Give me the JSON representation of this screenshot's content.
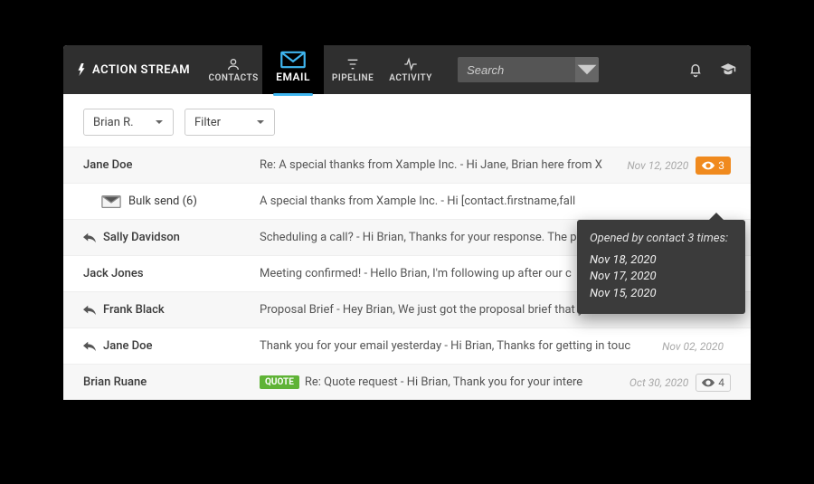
{
  "header": {
    "brand": "ACTION STREAM",
    "nav": [
      {
        "key": "contacts",
        "label": "CONTACTS"
      },
      {
        "key": "email",
        "label": "EMAIL",
        "active": true
      },
      {
        "key": "pipeline",
        "label": "PIPELINE"
      },
      {
        "key": "activity",
        "label": "ACTIVITY"
      }
    ],
    "search_placeholder": "Search"
  },
  "filters": {
    "person": "Brian R.",
    "label": "Filter"
  },
  "tooltip": {
    "head": "Opened by contact 3 times:",
    "dates": [
      "Nov 18, 2020",
      "Nov 17, 2020",
      "Nov 15, 2020"
    ]
  },
  "rows": [
    {
      "kind": "normal",
      "sender": "Jane Doe",
      "body": "Re: A special thanks from Xample Inc. - Hi Jane, Brian here from X",
      "date": "Nov 12, 2020",
      "opens": "3",
      "opens_hot": true
    },
    {
      "kind": "bulk",
      "sender": "Bulk send (6)",
      "body": "A special thanks from Xample Inc. - Hi [contact.firstname,fall",
      "date": "",
      "opens": ""
    },
    {
      "kind": "reply",
      "sender": "Sally Davidson",
      "body": "Scheduling a call? - Hi Brian, Thanks for your response. The p",
      "date": "",
      "opens": ""
    },
    {
      "kind": "normal",
      "sender": "Jack Jones",
      "body": "Meeting confirmed! - Hello Brian, I'm following up after our c",
      "date": "",
      "opens": ""
    },
    {
      "kind": "reply",
      "sender": "Frank Black",
      "body": "Proposal Brief - Hey Brian, We just got the proposal brief that y",
      "date": "",
      "opens": ""
    },
    {
      "kind": "reply",
      "sender": "Jane Doe",
      "body": "Thank you for your email yesterday - Hi Brian, Thanks for getting in touc",
      "date": "Nov 02, 2020",
      "opens": ""
    },
    {
      "kind": "quote",
      "tag": "QUOTE",
      "sender": "Brian Ruane",
      "body": "Re: Quote request - Hi Brian, Thank you for your intere",
      "date": "Oct 30, 2020",
      "opens": "4"
    }
  ]
}
